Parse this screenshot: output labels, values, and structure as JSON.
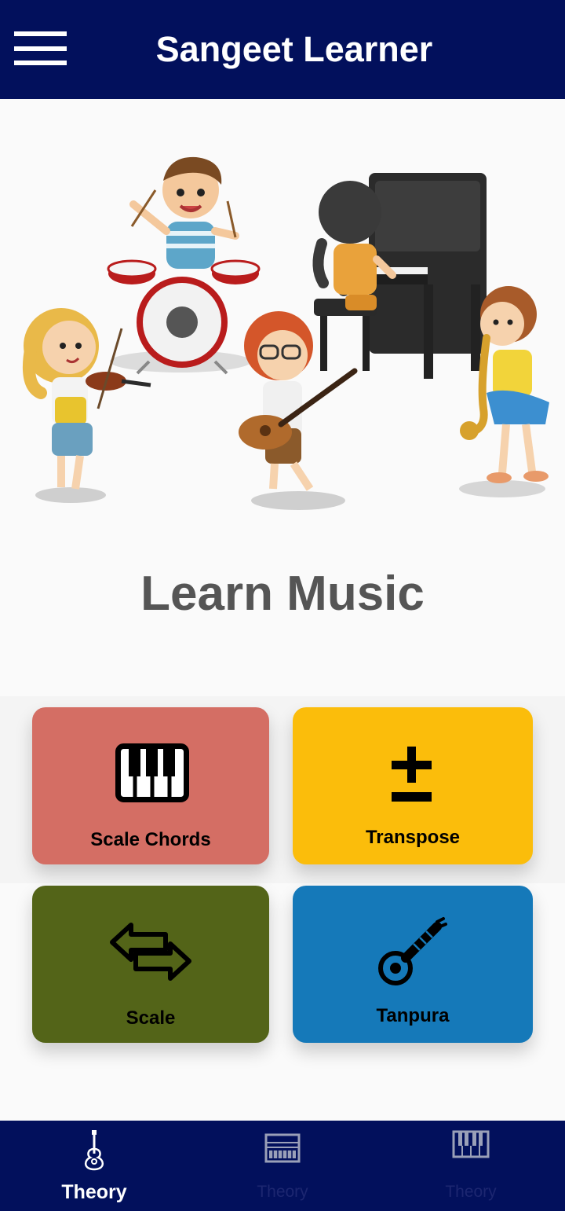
{
  "appbar": {
    "title": "Sangeet Learner",
    "menu_icon": "hamburger-menu-icon"
  },
  "hero": {
    "illustration": "kids-playing-instruments-illustration"
  },
  "main": {
    "heading": "Learn Music"
  },
  "tiles": [
    {
      "label": "Scale Chords",
      "icon": "piano-keys-icon",
      "color": "#d46e64"
    },
    {
      "label": "Transpose",
      "icon": "plus-minus-icon",
      "color": "#fbbd0b"
    },
    {
      "label": "Scale",
      "icon": "swap-arrows-icon",
      "color": "#536418"
    },
    {
      "label": "Tanpura",
      "icon": "sitar-icon",
      "color": "#1579b9"
    }
  ],
  "bottom_nav": {
    "items": [
      {
        "label": "Theory",
        "icon": "guitar-icon",
        "active": true
      },
      {
        "label": "Theory",
        "icon": "harmonium-icon",
        "active": false
      },
      {
        "label": "Theory",
        "icon": "piano-icon",
        "active": false
      }
    ]
  },
  "colors": {
    "primary": "#02105c",
    "heading_text": "#555555"
  }
}
